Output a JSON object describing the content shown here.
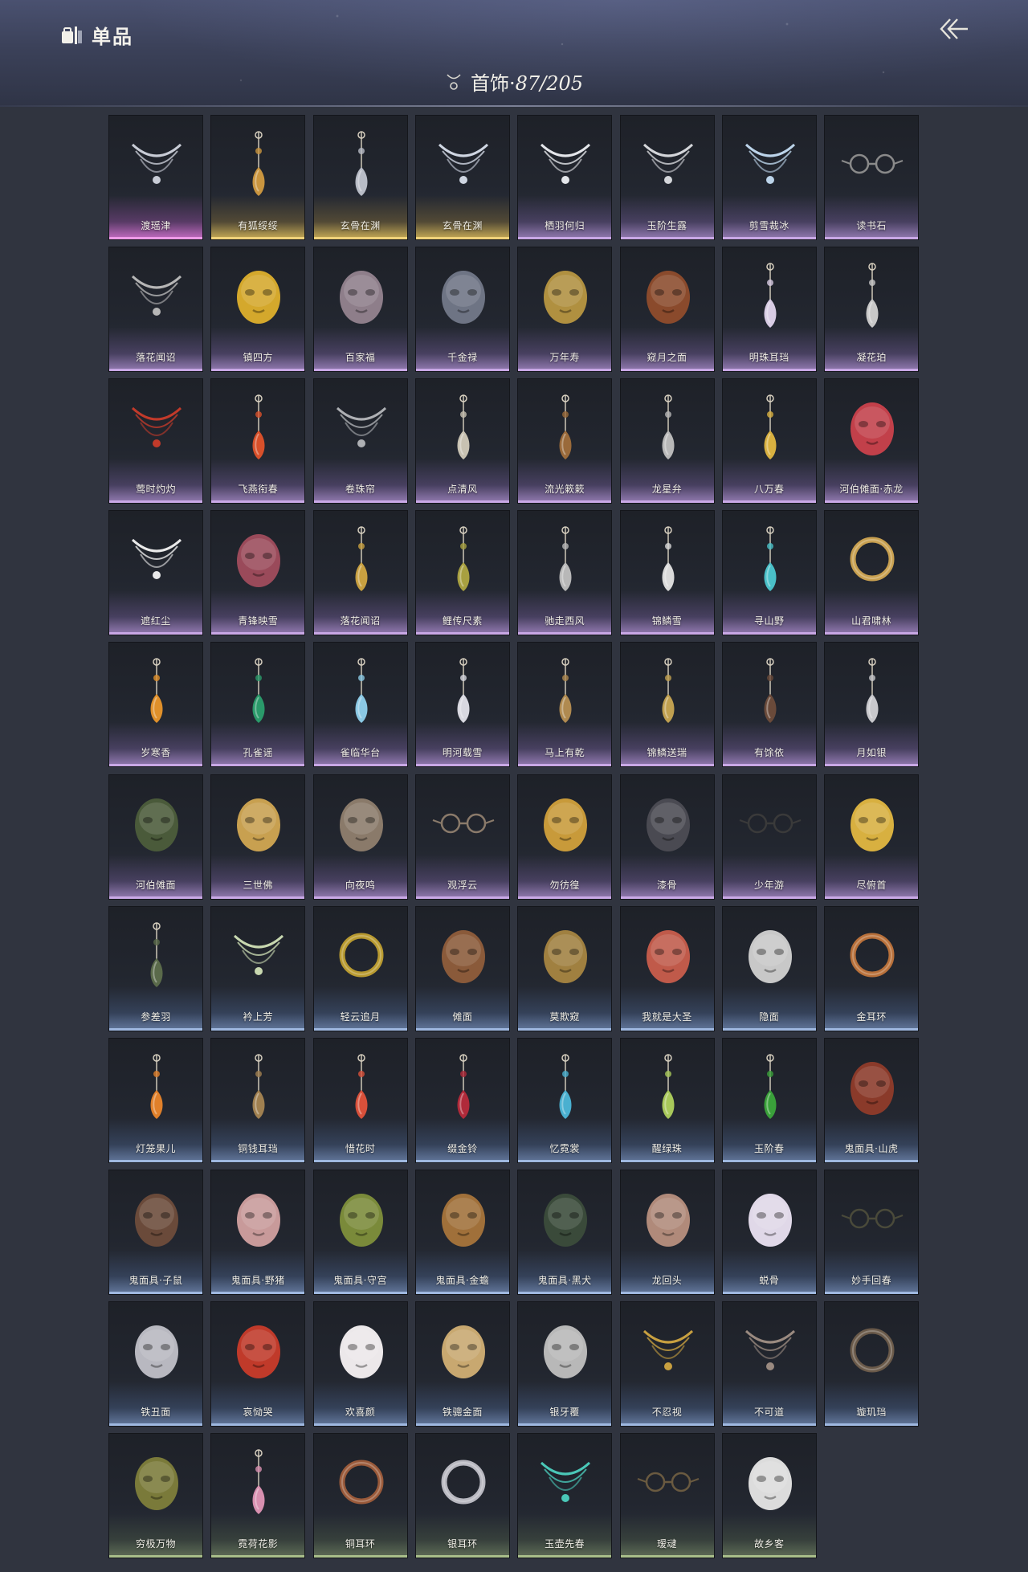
{
  "header": {
    "brand_text": "单品",
    "section_label": "首饰·",
    "count_text": "87/205"
  },
  "items": [
    {
      "label": "渡瑶津",
      "rarity": "pink",
      "icon": "silver-chain-necklace-icon",
      "color": "#c8ccd6"
    },
    {
      "label": "有狐绥绥",
      "rarity": "gold",
      "icon": "gold-fox-pendant-icon",
      "color": "#c9953f"
    },
    {
      "label": "玄骨在渊",
      "rarity": "gold",
      "icon": "ring-pendant-icon",
      "color": "#b8bcc6"
    },
    {
      "label": "玄骨在渊",
      "rarity": "gold",
      "icon": "thorn-circlet-icon",
      "color": "#cfd6e2"
    },
    {
      "label": "栖羽何归",
      "rarity": "purple",
      "icon": "white-wing-icon",
      "color": "#e4e6ea"
    },
    {
      "label": "玉阶生露",
      "rarity": "purple",
      "icon": "bead-veil-icon",
      "color": "#d4d6da"
    },
    {
      "label": "剪雪裁冰",
      "rarity": "purple",
      "icon": "ice-crown-icon",
      "color": "#bcd4ea"
    },
    {
      "label": "读书石",
      "rarity": "purple",
      "icon": "round-glasses-icon",
      "color": "#8a8a8a"
    },
    {
      "label": "落花闻诏",
      "rarity": "purple",
      "icon": "silk-scarf-icon",
      "color": "#b6b6b6"
    },
    {
      "label": "镇四方",
      "rarity": "purple",
      "icon": "gold-phoenix-mask-icon",
      "color": "#d4a82c"
    },
    {
      "label": "百家福",
      "rarity": "purple",
      "icon": "rat-mask-icon",
      "color": "#8e7e8a"
    },
    {
      "label": "千金禄",
      "rarity": "purple",
      "icon": "rat-mask-icon",
      "color": "#6e7484"
    },
    {
      "label": "万年寿",
      "rarity": "purple",
      "icon": "rat-mask-icon",
      "color": "#b09040"
    },
    {
      "label": "窥月之面",
      "rarity": "purple",
      "icon": "lion-mask-icon",
      "color": "#8a4a2c"
    },
    {
      "label": "明珠耳珰",
      "rarity": "purple",
      "icon": "pearl-earring-icon",
      "color": "#d8cce4"
    },
    {
      "label": "凝花珀",
      "rarity": "purple",
      "icon": "flower-pendant-icon",
      "color": "#c8c8c8"
    },
    {
      "label": "莺时灼灼",
      "rarity": "purple",
      "icon": "red-veil-icon",
      "color": "#c23a2a"
    },
    {
      "label": "飞燕衔春",
      "rarity": "purple",
      "icon": "red-swallow-hairpin-icon",
      "color": "#d8502a"
    },
    {
      "label": "卷珠帘",
      "rarity": "purple",
      "icon": "bead-curtain-icon",
      "color": "#aeb0b4"
    },
    {
      "label": "点清风",
      "rarity": "purple",
      "icon": "fan-pendant-icon",
      "color": "#c8c2b2"
    },
    {
      "label": "流光簌簌",
      "rarity": "purple",
      "icon": "tassel-hairpin-icon",
      "color": "#9a6a3a"
    },
    {
      "label": "龙星弁",
      "rarity": "purple",
      "icon": "dragon-hairpin-icon",
      "color": "#b8b8b8"
    },
    {
      "label": "八万春",
      "rarity": "purple",
      "icon": "gold-flower-hairpin-icon",
      "color": "#d8b040"
    },
    {
      "label": "河伯傩面·赤龙",
      "rarity": "purple",
      "icon": "red-dragon-mask-icon",
      "color": "#c2404a"
    },
    {
      "label": "遮红尘",
      "rarity": "purple",
      "icon": "white-sash-icon",
      "color": "#eaeaea"
    },
    {
      "label": "青锋映雪",
      "rarity": "purple",
      "icon": "silk-mask-icon",
      "color": "#9a4a5a"
    },
    {
      "label": "落花闻诏",
      "rarity": "purple",
      "icon": "gold-hairpin-icon",
      "color": "#c8a040"
    },
    {
      "label": "鲤传尺素",
      "rarity": "purple",
      "icon": "fish-earring-icon",
      "color": "#a8a040"
    },
    {
      "label": "驰走西风",
      "rarity": "purple",
      "icon": "feather-earring-icon",
      "color": "#b8b8b8"
    },
    {
      "label": "锦鳞雪",
      "rarity": "purple",
      "icon": "silver-leaf-earring-icon",
      "color": "#dadada"
    },
    {
      "label": "寻山野",
      "rarity": "purple",
      "icon": "turquoise-earring-icon",
      "color": "#4ac0c8"
    },
    {
      "label": "山君啸林",
      "rarity": "purple",
      "icon": "gold-hoop-earring-icon",
      "color": "#c8a050"
    },
    {
      "label": "岁寒香",
      "rarity": "purple",
      "icon": "amber-earring-icon",
      "color": "#e0902a"
    },
    {
      "label": "孔雀谣",
      "rarity": "purple",
      "icon": "emerald-earring-icon",
      "color": "#2a9a6a"
    },
    {
      "label": "雀临华台",
      "rarity": "purple",
      "icon": "blue-flower-earring-icon",
      "color": "#8ac8e4"
    },
    {
      "label": "明河载雪",
      "rarity": "purple",
      "icon": "diamond-drop-earring-icon",
      "color": "#d8d8e0"
    },
    {
      "label": "马上有乾",
      "rarity": "purple",
      "icon": "horn-earring-icon",
      "color": "#b08a50"
    },
    {
      "label": "锦鳞送瑞",
      "rarity": "purple",
      "icon": "gold-stick-hairpin-icon",
      "color": "#c0a050"
    },
    {
      "label": "有馀依",
      "rarity": "purple",
      "icon": "dark-hairpin-icon",
      "color": "#6a4a3a"
    },
    {
      "label": "月如银",
      "rarity": "purple",
      "icon": "silver-tassel-earring-icon",
      "color": "#c8c8cc"
    },
    {
      "label": "河伯傩面",
      "rarity": "purple",
      "icon": "green-dragon-mask-icon",
      "color": "#4a5a3a"
    },
    {
      "label": "三世佛",
      "rarity": "purple",
      "icon": "three-face-mask-icon",
      "color": "#c8a050"
    },
    {
      "label": "向夜鸣",
      "rarity": "purple",
      "icon": "owl-mask-icon",
      "color": "#8a7a6a"
    },
    {
      "label": "观浮云",
      "rarity": "purple",
      "icon": "goggles-icon",
      "color": "#8a7a6a"
    },
    {
      "label": "勿彷徨",
      "rarity": "purple",
      "icon": "gold-eye-mask-icon",
      "color": "#c89a3a"
    },
    {
      "label": "漆骨",
      "rarity": "purple",
      "icon": "dark-skull-mask-icon",
      "color": "#4a4a52"
    },
    {
      "label": "少年游",
      "rarity": "purple",
      "icon": "headband-icon",
      "color": "#3a3a3a"
    },
    {
      "label": "尽俯首",
      "rarity": "purple",
      "icon": "gold-face-mask-icon",
      "color": "#d8b040"
    },
    {
      "label": "参差羽",
      "rarity": "blue",
      "icon": "feather-hairpin-icon",
      "color": "#5a6a4a"
    },
    {
      "label": "衿上芳",
      "rarity": "blue",
      "icon": "jade-circlet-icon",
      "color": "#c8d8b0"
    },
    {
      "label": "轻云追月",
      "rarity": "blue",
      "icon": "gold-snake-bracelet-icon",
      "color": "#b89a30"
    },
    {
      "label": "傩面",
      "rarity": "blue",
      "icon": "demon-mask-icon",
      "color": "#8a5a3a"
    },
    {
      "label": "莫欺窥",
      "rarity": "blue",
      "icon": "gold-dragon-mask-icon",
      "color": "#a08040"
    },
    {
      "label": "我就是大圣",
      "rarity": "blue",
      "icon": "monkey-mask-icon",
      "color": "#c05a4a"
    },
    {
      "label": "隐面",
      "rarity": "blue",
      "icon": "silver-face-mask-icon",
      "color": "#c8c8c8"
    },
    {
      "label": "金耳环",
      "rarity": "blue",
      "icon": "copper-hoop-icon",
      "color": "#b8703a"
    },
    {
      "label": "灯笼果儿",
      "rarity": "blue",
      "icon": "lantern-fruit-earring-icon",
      "color": "#e0802a"
    },
    {
      "label": "铜钱耳珰",
      "rarity": "blue",
      "icon": "coin-earring-icon",
      "color": "#a08050"
    },
    {
      "label": "惜花时",
      "rarity": "blue",
      "icon": "petal-earring-icon",
      "color": "#d8503a"
    },
    {
      "label": "缀金铃",
      "rarity": "blue",
      "icon": "red-tassel-earring-icon",
      "color": "#b02a3a"
    },
    {
      "label": "忆霓裳",
      "rarity": "blue",
      "icon": "crystal-earring-icon",
      "color": "#4ab0d0"
    },
    {
      "label": "醒绿珠",
      "rarity": "blue",
      "icon": "grape-earring-icon",
      "color": "#a8c85a"
    },
    {
      "label": "玉阶春",
      "rarity": "blue",
      "icon": "green-bead-earring-icon",
      "color": "#3aa03a"
    },
    {
      "label": "鬼面具·山虎",
      "rarity": "blue",
      "icon": "tiger-mask-icon",
      "color": "#8a3a2a"
    },
    {
      "label": "鬼面具·子鼠",
      "rarity": "blue",
      "icon": "rat-demon-mask-icon",
      "color": "#6a4a3a"
    },
    {
      "label": "鬼面具·野猪",
      "rarity": "blue",
      "icon": "boar-mask-icon",
      "color": "#c89a9a"
    },
    {
      "label": "鬼面具·守宫",
      "rarity": "blue",
      "icon": "gecko-mask-icon",
      "color": "#7a8a3a"
    },
    {
      "label": "鬼面具·金蟾",
      "rarity": "blue",
      "icon": "toad-mask-icon",
      "color": "#a0703a"
    },
    {
      "label": "鬼面具·黑犬",
      "rarity": "blue",
      "icon": "dog-mask-icon",
      "color": "#3a4a3a"
    },
    {
      "label": "龙回头",
      "rarity": "blue",
      "icon": "dragon-head-mask-icon",
      "color": "#b08a7a"
    },
    {
      "label": "蜕骨",
      "rarity": "blue",
      "icon": "opera-mask-icon",
      "color": "#e0d8e8"
    },
    {
      "label": "妙手回春",
      "rarity": "blue",
      "icon": "small-glasses-icon",
      "color": "#4a4a3a"
    },
    {
      "label": "铁丑面",
      "rarity": "blue",
      "icon": "iron-skull-mask-icon",
      "color": "#b8b8c0"
    },
    {
      "label": "哀恸哭",
      "rarity": "blue",
      "icon": "red-oni-mask-icon",
      "color": "#c03a2a"
    },
    {
      "label": "欢喜颜",
      "rarity": "blue",
      "icon": "kabuki-mask-icon",
      "color": "#ece8ea"
    },
    {
      "label": "铁骢金面",
      "rarity": "blue",
      "icon": "tan-face-mask-icon",
      "color": "#c8a870"
    },
    {
      "label": "银牙覆",
      "rarity": "blue",
      "icon": "fang-mask-icon",
      "color": "#b8b8b8"
    },
    {
      "label": "不忍视",
      "rarity": "blue",
      "icon": "gold-blindfold-crown-icon",
      "color": "#c8a040"
    },
    {
      "label": "不可道",
      "rarity": "blue",
      "icon": "face-veil-icon",
      "color": "#9a8a80"
    },
    {
      "label": "璇玑珰",
      "rarity": "blue",
      "icon": "gear-ring-icon",
      "color": "#6a5a4a"
    },
    {
      "label": "穷极万物",
      "rarity": "green",
      "icon": "bronze-taotie-mask-icon",
      "color": "#7a7a3a"
    },
    {
      "label": "霓荷花影",
      "rarity": "green",
      "icon": "lotus-earring-icon",
      "color": "#d890b0"
    },
    {
      "label": "铜耳环",
      "rarity": "green",
      "icon": "copper-hoop-icon",
      "color": "#9a5a3a"
    },
    {
      "label": "银耳环",
      "rarity": "green",
      "icon": "silver-hoop-icon",
      "color": "#b8b8c0"
    },
    {
      "label": "玉壶先春",
      "rarity": "green",
      "icon": "jade-vase-icon",
      "color": "#4ac8b8"
    },
    {
      "label": "瑷叇",
      "rarity": "green",
      "icon": "monocle-glasses-icon",
      "color": "#6a5a40"
    },
    {
      "label": "故乡客",
      "rarity": "green",
      "icon": "white-half-mask-icon",
      "color": "#dcdcdc"
    }
  ]
}
